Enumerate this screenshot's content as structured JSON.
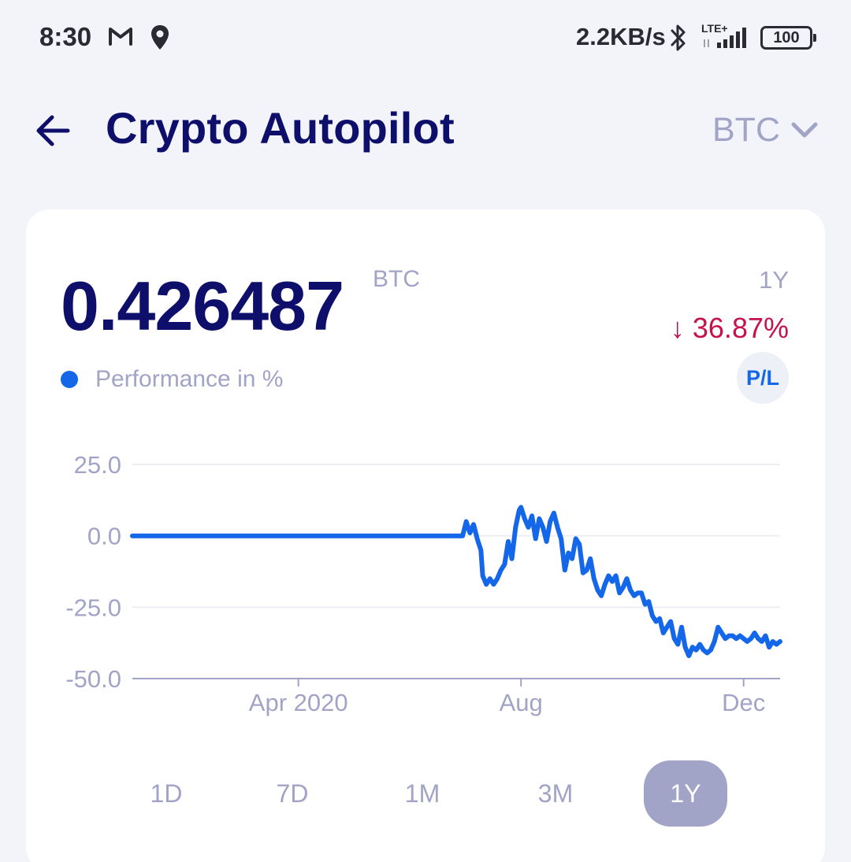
{
  "status_bar": {
    "time": "8:30",
    "network_speed": "2.2KB/s",
    "network_type": "LTE+",
    "battery": "100",
    "icons": [
      "gmail-icon",
      "location-icon",
      "bluetooth-icon",
      "signal-icon",
      "battery-icon"
    ]
  },
  "header": {
    "title": "Crypto Autopilot",
    "currency": "BTC",
    "icons": [
      "back-arrow-icon",
      "chevron-down-icon"
    ]
  },
  "summary": {
    "balance": "0.426487",
    "unit": "BTC",
    "period": "1Y",
    "change": "↓ 36.87%",
    "legend": "Performance in %",
    "pl_button": "P/L"
  },
  "colors": {
    "title": "#0e0f6b",
    "muted": "#a1a3c7",
    "line": "#1467e8",
    "negative": "#c8114c",
    "background": "#f3f4fa"
  },
  "range_tabs": [
    {
      "label": "1D",
      "active": false
    },
    {
      "label": "7D",
      "active": false
    },
    {
      "label": "1M",
      "active": false
    },
    {
      "label": "3M",
      "active": false
    },
    {
      "label": "1Y",
      "active": true
    }
  ],
  "chart_data": {
    "type": "line",
    "grid": true,
    "ylim": [
      -50,
      25
    ],
    "y_ticks": [
      "25.0",
      "0.0",
      "-25.0",
      "-50.0"
    ],
    "y_tick_values": [
      25,
      0,
      -25,
      -50
    ],
    "x_tick_labels": [
      "Apr 2020",
      "Aug",
      "Dec"
    ],
    "x_tick_dates": [
      "2020-04-01",
      "2020-08-01",
      "2020-12-01"
    ],
    "xlim": [
      "2020-01-01",
      "2020-12-21"
    ],
    "series": [
      {
        "name": "Performance in %",
        "color": "#1467e8",
        "x": [
          "2020-01-01",
          "2020-06-28",
          "2020-06-30",
          "2020-07-02",
          "2020-07-04",
          "2020-07-06",
          "2020-07-08",
          "2020-07-10",
          "2020-07-11",
          "2020-07-13",
          "2020-07-15",
          "2020-07-17",
          "2020-07-19",
          "2020-07-21",
          "2020-07-23",
          "2020-07-25",
          "2020-07-27",
          "2020-07-29",
          "2020-07-31",
          "2020-08-01",
          "2020-08-03",
          "2020-08-05",
          "2020-08-07",
          "2020-08-09",
          "2020-08-11",
          "2020-08-13",
          "2020-08-15",
          "2020-08-17",
          "2020-08-19",
          "2020-08-21",
          "2020-08-23",
          "2020-08-25",
          "2020-08-27",
          "2020-08-29",
          "2020-08-31",
          "2020-09-02",
          "2020-09-04",
          "2020-09-06",
          "2020-09-08",
          "2020-09-10",
          "2020-09-12",
          "2020-09-14",
          "2020-09-16",
          "2020-09-18",
          "2020-09-20",
          "2020-09-22",
          "2020-09-24",
          "2020-09-26",
          "2020-09-28",
          "2020-09-30",
          "2020-10-02",
          "2020-10-04",
          "2020-10-06",
          "2020-10-08",
          "2020-10-10",
          "2020-10-12",
          "2020-10-14",
          "2020-10-16",
          "2020-10-18",
          "2020-10-20",
          "2020-10-22",
          "2020-10-24",
          "2020-10-26",
          "2020-10-28",
          "2020-10-30",
          "2020-11-01",
          "2020-11-03",
          "2020-11-05",
          "2020-11-07",
          "2020-11-09",
          "2020-11-11",
          "2020-11-13",
          "2020-11-15",
          "2020-11-17",
          "2020-11-19",
          "2020-11-21",
          "2020-11-23",
          "2020-11-25",
          "2020-11-27",
          "2020-11-29",
          "2020-12-01",
          "2020-12-03",
          "2020-12-05",
          "2020-12-07",
          "2020-12-09",
          "2020-12-11",
          "2020-12-13",
          "2020-12-15",
          "2020-12-17",
          "2020-12-19",
          "2020-12-21"
        ],
        "y": [
          0,
          0,
          0,
          5,
          1,
          4,
          -1,
          -5,
          -14,
          -17,
          -15,
          -17,
          -15,
          -12,
          -10,
          -2,
          -8,
          3,
          9,
          10,
          6,
          3,
          7,
          -1,
          6,
          3,
          -2,
          5,
          8,
          3,
          -1,
          -12,
          -6,
          -8,
          -1,
          -3,
          -13,
          -12,
          -8,
          -15,
          -19,
          -21,
          -17,
          -14,
          -16,
          -14,
          -20,
          -18,
          -15,
          -19,
          -21,
          -20,
          -20,
          -24,
          -23,
          -28,
          -30,
          -29,
          -34,
          -32,
          -30,
          -36,
          -38,
          -32,
          -39,
          -42,
          -39,
          -40,
          -38,
          -40,
          -41,
          -40,
          -37,
          -32,
          -34,
          -36,
          -35,
          -35,
          -36,
          -35,
          -36,
          -37,
          -36,
          -34,
          -36,
          -37,
          -35,
          -39,
          -37,
          -38,
          -37
        ]
      }
    ]
  }
}
